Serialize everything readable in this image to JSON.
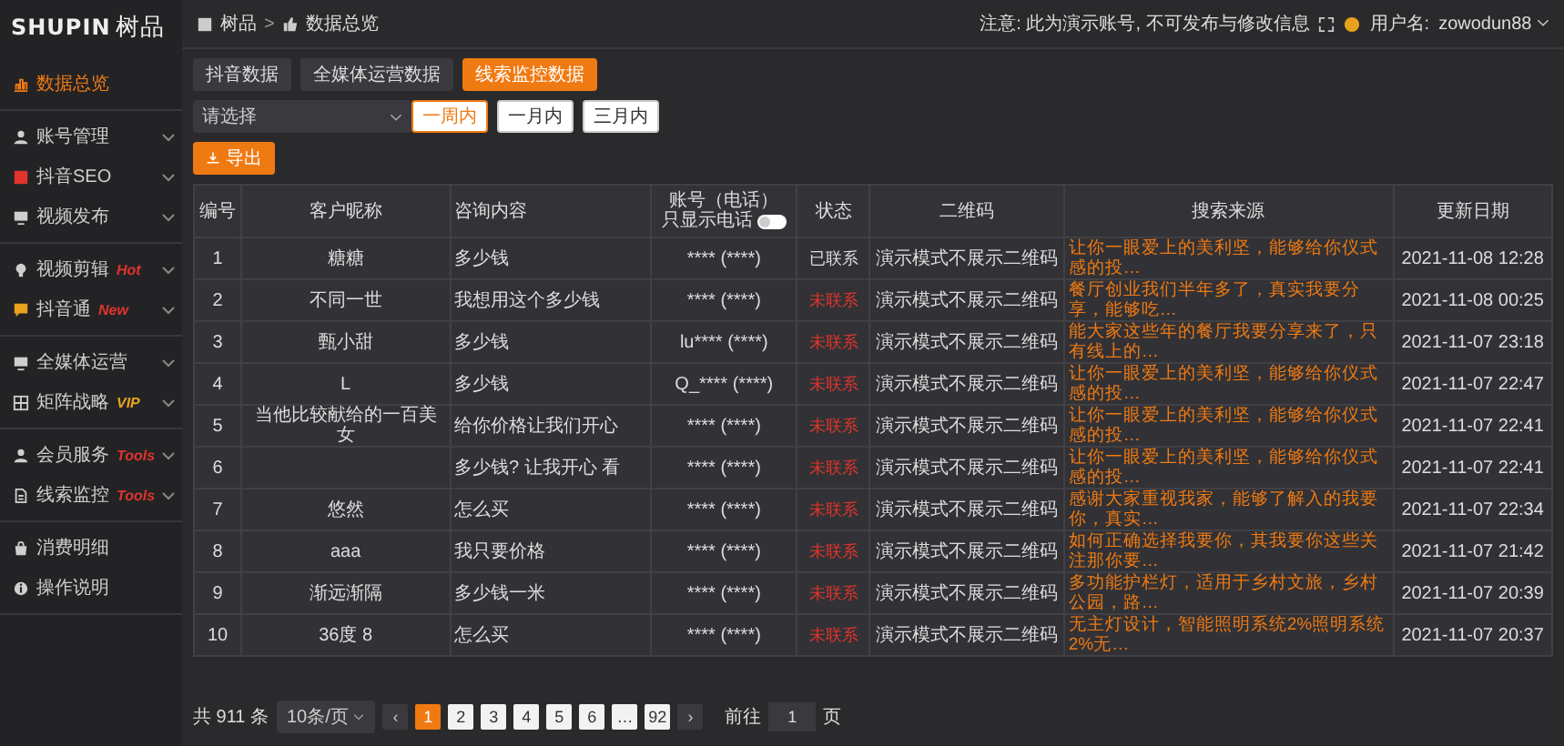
{
  "logo": {
    "latin": "SHUPIN",
    "cjk": "树品"
  },
  "sidebar": {
    "groups": [
      [
        {
          "label": "数据总览",
          "selected": true,
          "expandable": false
        }
      ],
      [
        {
          "label": "账号管理",
          "selected": false,
          "expandable": true
        },
        {
          "label": "抖音SEO",
          "selected": false,
          "expandable": true
        },
        {
          "label": "视频发布",
          "selected": false,
          "expandable": true
        }
      ],
      [
        {
          "label": "视频剪辑",
          "badge": "Hot",
          "color": "#e0342c",
          "selected": false,
          "expandable": true
        },
        {
          "label": "抖音通",
          "badge": "New",
          "color": "#e0342c",
          "selected": false,
          "expandable": true
        }
      ],
      [
        {
          "label": "全媒体运营",
          "selected": false,
          "expandable": true
        },
        {
          "label": "矩阵战略",
          "badge": "VIP",
          "color": "#e8a21c",
          "selected": false,
          "expandable": true
        }
      ],
      [
        {
          "label": "会员服务",
          "badge": "Tools",
          "color": "#e0342c",
          "selected": false,
          "expandable": true
        },
        {
          "label": "线索监控",
          "badge": "Tools",
          "color": "#e0342c",
          "selected": false,
          "expandable": true
        }
      ],
      [
        {
          "label": "消费明细",
          "selected": false,
          "expandable": false
        },
        {
          "label": "操作说明",
          "selected": false,
          "expandable": false
        }
      ]
    ]
  },
  "breadcrumb": [
    "树品",
    "数据总览"
  ],
  "breadcrumb_separator": ">",
  "notice": "注意: 此为演示账号, 不可发布与修改信息",
  "user": {
    "label": "用户名:",
    "name": "zowodun88"
  },
  "tabs": [
    {
      "label": "抖音数据",
      "selected": false
    },
    {
      "label": "全媒体运营数据",
      "selected": false
    },
    {
      "label": "线索监控数据",
      "selected": true
    }
  ],
  "filter": {
    "placeholder": "请选择",
    "ranges": [
      {
        "label": "一周内",
        "selected": true
      },
      {
        "label": "一月内",
        "selected": false
      },
      {
        "label": "三月内",
        "selected": false
      }
    ]
  },
  "export_button": "导出",
  "table": {
    "columns": [
      "编号",
      "客户昵称",
      "咨询内容",
      "账号（电话）",
      "状态",
      "二维码",
      "搜索来源",
      "更新日期"
    ],
    "phone_toggle": {
      "label": "只显示电话",
      "on": false
    },
    "rows": [
      {
        "no": "1",
        "nickname": "糖糖",
        "content": "多少钱",
        "account": "**** (****)",
        "status": "已联系",
        "contacted": true,
        "qrcode": "演示模式不展示二维码",
        "source": "让你一眼爱上的美利坚，能够给你仪式感的投…",
        "date": "2021-11-08 12:28"
      },
      {
        "no": "2",
        "nickname": "不同一世",
        "content": "我想用这个多少钱",
        "account": "**** (****)",
        "status": "未联系",
        "contacted": false,
        "qrcode": "演示模式不展示二维码",
        "source": "餐厅创业我们半年多了，真实我要分享，能够吃…",
        "date": "2021-11-08 00:25"
      },
      {
        "no": "3",
        "nickname": "甄小甜",
        "content": "多少钱",
        "account": "lu**** (****)",
        "status": "未联系",
        "contacted": false,
        "qrcode": "演示模式不展示二维码",
        "source": "能大家这些年的餐厅我要分享来了，只有线上的…",
        "date": "2021-11-07 23:18"
      },
      {
        "no": "4",
        "nickname": "L",
        "content": "多少钱",
        "account": "Q_**** (****)",
        "status": "未联系",
        "contacted": false,
        "qrcode": "演示模式不展示二维码",
        "source": "让你一眼爱上的美利坚，能够给你仪式感的投…",
        "date": "2021-11-07 22:47"
      },
      {
        "no": "5",
        "nickname": "当他比较献给的一百美女",
        "content": "给你价格让我们开心",
        "account": "**** (****)",
        "status": "未联系",
        "contacted": false,
        "qrcode": "演示模式不展示二维码",
        "source": "让你一眼爱上的美利坚，能够给你仪式感的投…",
        "date": "2021-11-07 22:41"
      },
      {
        "no": "6",
        "nickname": "",
        "content": "多少钱? 让我开心 看",
        "account": "**** (****)",
        "status": "未联系",
        "contacted": false,
        "qrcode": "演示模式不展示二维码",
        "source": "让你一眼爱上的美利坚，能够给你仪式感的投…",
        "date": "2021-11-07 22:41"
      },
      {
        "no": "7",
        "nickname": "悠然",
        "content": "怎么买",
        "account": "**** (****)",
        "status": "未联系",
        "contacted": false,
        "qrcode": "演示模式不展示二维码",
        "source": "感谢大家重视我家，能够了解入的我要你，真实…",
        "date": "2021-11-07 22:34"
      },
      {
        "no": "8",
        "nickname": "aaa",
        "content": "我只要价格",
        "account": "**** (****)",
        "status": "未联系",
        "contacted": false,
        "qrcode": "演示模式不展示二维码",
        "source": "如何正确选择我要你，其我要你这些关注那你要…",
        "date": "2021-11-07 21:42"
      },
      {
        "no": "9",
        "nickname": "渐远渐隔",
        "content": "多少钱一米",
        "account": "**** (****)",
        "status": "未联系",
        "contacted": false,
        "qrcode": "演示模式不展示二维码",
        "source": "多功能护栏灯，适用于乡村文旅，乡村公园，路…",
        "date": "2021-11-07 20:39"
      },
      {
        "no": "10",
        "nickname": "36度 8",
        "content": "怎么买",
        "account": "**** (****)",
        "status": "未联系",
        "contacted": false,
        "qrcode": "演示模式不展示二维码",
        "source": "无主灯设计，智能照明系统2%照明系统2%无…",
        "date": "2021-11-07 20:37"
      }
    ]
  },
  "pagination": {
    "total": "共 911 条",
    "page_size": "10条/页",
    "pages": [
      {
        "label": "1",
        "selected": true
      },
      {
        "label": "2",
        "selected": false
      },
      {
        "label": "3",
        "selected": false
      },
      {
        "label": "4",
        "selected": false
      },
      {
        "label": "5",
        "selected": false
      },
      {
        "label": "6",
        "selected": false
      },
      {
        "label": "…",
        "selected": false
      },
      {
        "label": "92",
        "selected": false
      }
    ],
    "prev": "‹",
    "next": "›",
    "goto_label": "前往",
    "goto_value": "1",
    "goto_suffix": "页"
  }
}
